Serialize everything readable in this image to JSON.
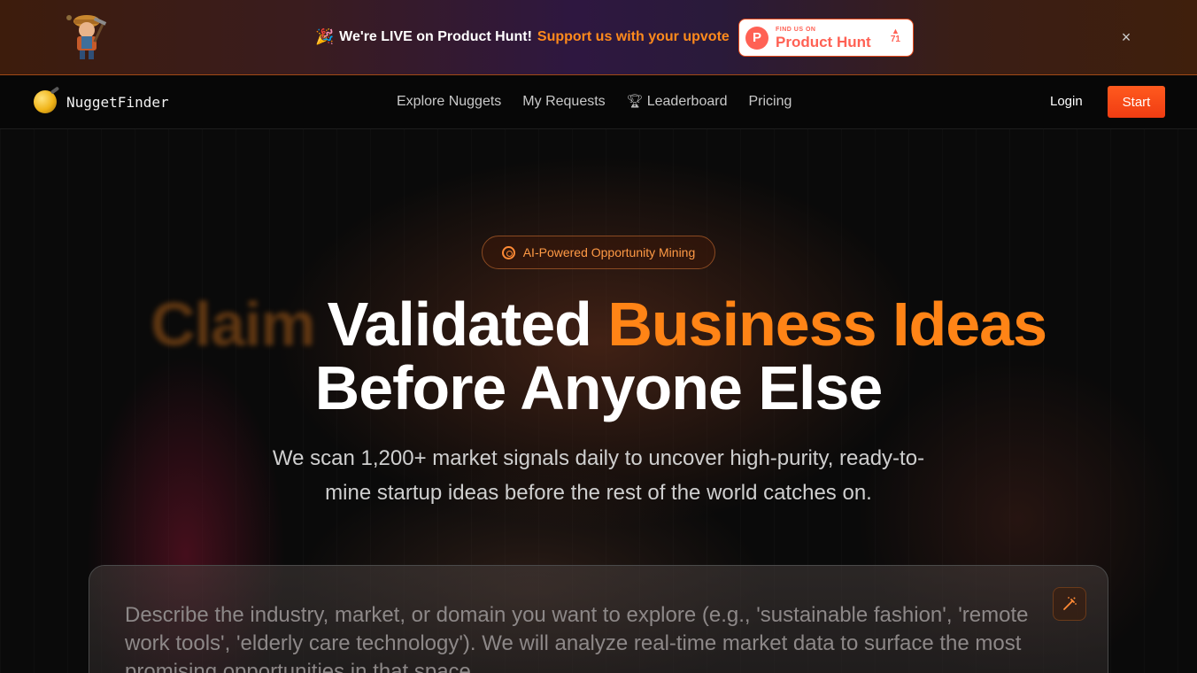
{
  "banner": {
    "party_icon": "party-popper-icon",
    "message": "We're LIVE on Product Hunt!",
    "cta": "Support us with your upvote",
    "product_hunt": {
      "small_label": "FIND US ON",
      "name": "Product Hunt",
      "votes": "71",
      "logo_letter": "P"
    },
    "close_glyph": "×"
  },
  "nav": {
    "brand": "NuggetFinder",
    "links": [
      {
        "label": "Explore Nuggets"
      },
      {
        "label": "My Requests"
      },
      {
        "label": "Leaderboard",
        "icon": "trophy-icon"
      },
      {
        "label": "Pricing"
      }
    ],
    "login": "Login",
    "start": "Start"
  },
  "hero": {
    "pill": "AI-Powered Opportunity Mining",
    "headline_ghost": "Claim",
    "headline_white": "Validated",
    "headline_accent": "Business Ideas",
    "headline_line2": "Before Anyone Else",
    "subcopy": "We scan 1,200+ market signals daily to uncover high-purity, ready-to-mine startup ideas before the rest of the world catches on.",
    "prompt_placeholder": "Describe the industry, market, or domain you want to explore (e.g., 'sustainable fashion', 'remote work tools', 'elderly care technology'). We will analyze real-time market data to surface the most promising opportunities in that space."
  },
  "colors": {
    "accent": "#ff8416",
    "start_button": "#f04a16",
    "product_hunt": "#ff6154"
  }
}
